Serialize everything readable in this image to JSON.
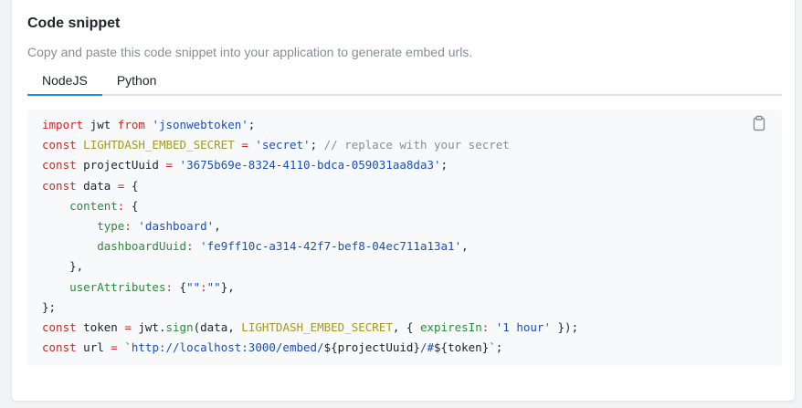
{
  "section": {
    "title": "Code snippet",
    "description": "Copy and paste this code snippet into your application to generate embed urls."
  },
  "tabs": [
    {
      "label": "NodeJS",
      "active": true
    },
    {
      "label": "Python",
      "active": false
    }
  ],
  "code": {
    "copy_icon": "clipboard-icon",
    "lines": [
      [
        [
          "kw",
          "import"
        ],
        [
          "",
          "&nbsp;jwt&nbsp;"
        ],
        [
          "kw",
          "from"
        ],
        [
          "",
          "&nbsp;"
        ],
        [
          "str",
          "'jsonwebtoken'"
        ],
        [
          "",
          ";"
        ]
      ],
      [
        [
          "kw",
          "const"
        ],
        [
          "",
          "&nbsp;"
        ],
        [
          "yl",
          "LIGHTDASH_EMBED_SECRET"
        ],
        [
          "",
          "&nbsp;"
        ],
        [
          "kw",
          "="
        ],
        [
          "",
          "&nbsp;"
        ],
        [
          "str",
          "'secret'"
        ],
        [
          "",
          ";&nbsp;"
        ],
        [
          "cm",
          "// replace with your secret"
        ]
      ],
      [
        [
          "kw",
          "const"
        ],
        [
          "",
          "&nbsp;projectUuid&nbsp;"
        ],
        [
          "kw",
          "="
        ],
        [
          "",
          "&nbsp;"
        ],
        [
          "str",
          "'3675b69e-8324-4110-bdca-059031aa8da3'"
        ],
        [
          "",
          ";"
        ]
      ],
      [
        [
          "kw",
          "const"
        ],
        [
          "",
          "&nbsp;data&nbsp;"
        ],
        [
          "kw",
          "="
        ],
        [
          "",
          "&nbsp;{"
        ]
      ],
      [
        [
          "",
          "&nbsp;&nbsp;&nbsp;&nbsp;"
        ],
        [
          "gr",
          "content"
        ],
        [
          "kw",
          ":"
        ],
        [
          "",
          "&nbsp;{"
        ]
      ],
      [
        [
          "",
          "&nbsp;&nbsp;&nbsp;&nbsp;&nbsp;&nbsp;&nbsp;&nbsp;"
        ],
        [
          "gr",
          "type"
        ],
        [
          "kw",
          ":"
        ],
        [
          "",
          "&nbsp;"
        ],
        [
          "str",
          "'dashboard'"
        ],
        [
          "",
          ","
        ]
      ],
      [
        [
          "",
          "&nbsp;&nbsp;&nbsp;&nbsp;&nbsp;&nbsp;&nbsp;&nbsp;"
        ],
        [
          "gr",
          "dashboardUuid"
        ],
        [
          "kw",
          ":"
        ],
        [
          "",
          "&nbsp;"
        ],
        [
          "str",
          "'fe9ff10c-a314-42f7-bef8-04ec711a13a1'"
        ],
        [
          "",
          ","
        ]
      ],
      [
        [
          "",
          "&nbsp;&nbsp;&nbsp;&nbsp;},"
        ]
      ],
      [
        [
          "",
          "&nbsp;&nbsp;&nbsp;&nbsp;"
        ],
        [
          "gr",
          "userAttributes"
        ],
        [
          "kw",
          ":"
        ],
        [
          "",
          "&nbsp;{"
        ],
        [
          "str",
          "\"\""
        ],
        [
          "kw",
          ":"
        ],
        [
          "str",
          "\"\""
        ],
        [
          "",
          "},"
        ]
      ],
      [
        [
          "",
          "};"
        ]
      ],
      [
        [
          "kw",
          "const"
        ],
        [
          "",
          "&nbsp;token&nbsp;"
        ],
        [
          "kw",
          "="
        ],
        [
          "",
          "&nbsp;jwt."
        ],
        [
          "gr",
          "sign"
        ],
        [
          "",
          "(data,&nbsp;"
        ],
        [
          "yl",
          "LIGHTDASH_EMBED_SECRET"
        ],
        [
          "",
          ",&nbsp;{&nbsp;"
        ],
        [
          "gr",
          "expiresIn"
        ],
        [
          "kw",
          ":"
        ],
        [
          "",
          "&nbsp;"
        ],
        [
          "str",
          "'1 hour'"
        ],
        [
          "",
          "&nbsp;});"
        ]
      ],
      [
        [
          "kw",
          "const"
        ],
        [
          "",
          "&nbsp;url&nbsp;"
        ],
        [
          "kw",
          "="
        ],
        [
          "",
          "&nbsp;"
        ],
        [
          "str",
          "`http://localhost:3000/embed/"
        ],
        [
          "",
          "${projectUuid}"
        ],
        [
          "str",
          "/#"
        ],
        [
          "",
          "${token}"
        ],
        [
          "str",
          "`"
        ],
        [
          "",
          ";"
        ]
      ]
    ]
  }
}
